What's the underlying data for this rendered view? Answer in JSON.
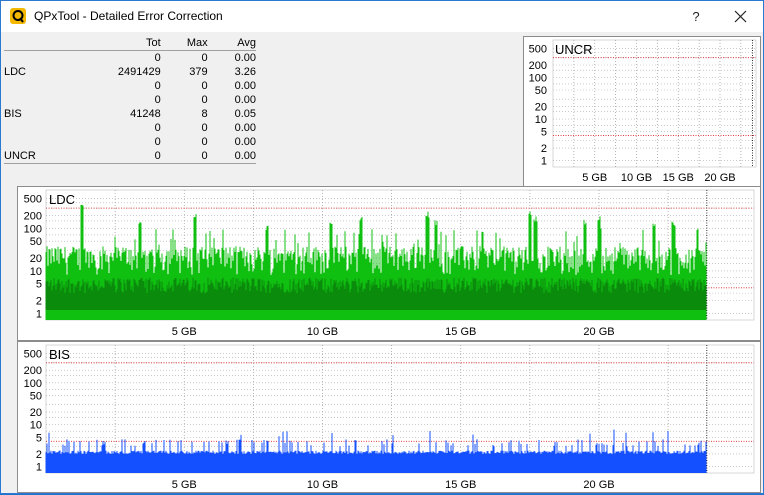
{
  "window": {
    "title": "QPxTool - Detailed Error Correction",
    "help_label": "?"
  },
  "stats": {
    "headers": [
      "",
      "Tot",
      "Max",
      "Avg"
    ],
    "rows": [
      [
        "",
        "0",
        "0",
        "0.00"
      ],
      [
        "LDC",
        "2491429",
        "379",
        "3.26"
      ],
      [
        "",
        "0",
        "0",
        "0.00"
      ],
      [
        "",
        "0",
        "0",
        "0.00"
      ],
      [
        "BIS",
        "41248",
        "8",
        "0.05"
      ],
      [
        "",
        "0",
        "0",
        "0.00"
      ],
      [
        "",
        "0",
        "0",
        "0.00"
      ],
      [
        "UNCR",
        "0",
        "0",
        "0.00"
      ]
    ]
  },
  "chart_data": [
    {
      "type": "bar",
      "title": "UNCR",
      "y_ticks": [
        "500",
        "200",
        "100",
        "50",
        "20",
        "10",
        "5",
        "2",
        "1"
      ],
      "x_ticks": [
        "5 GB",
        "10 GB",
        "15 GB",
        "20 GB"
      ],
      "y_scale": "log",
      "ylim": [
        1,
        500
      ],
      "xlim_gb": [
        0,
        23.9
      ],
      "series": [
        {
          "values_note": "all zero",
          "max": 0
        }
      ]
    },
    {
      "type": "bar",
      "title": "LDC",
      "y_ticks": [
        "500",
        "200",
        "100",
        "50",
        "20",
        "10",
        "5",
        "2",
        "1"
      ],
      "x_ticks": [
        "5 GB",
        "10 GB",
        "15 GB",
        "20 GB"
      ],
      "y_scale": "log",
      "ylim": [
        1,
        500
      ],
      "xlim_gb": [
        0,
        23.9
      ],
      "series": [
        {
          "typical": 6,
          "max": 379
        }
      ],
      "color": "#00c000"
    },
    {
      "type": "bar",
      "title": "BIS",
      "y_ticks": [
        "500",
        "200",
        "100",
        "50",
        "20",
        "10",
        "5",
        "2",
        "1"
      ],
      "x_ticks": [
        "5 GB",
        "10 GB",
        "15 GB",
        "20 GB"
      ],
      "y_scale": "log",
      "ylim": [
        1,
        500
      ],
      "xlim_gb": [
        0,
        23.9
      ],
      "series": [
        {
          "typical": 2,
          "max": 8
        }
      ],
      "color": "#0050ff"
    }
  ]
}
